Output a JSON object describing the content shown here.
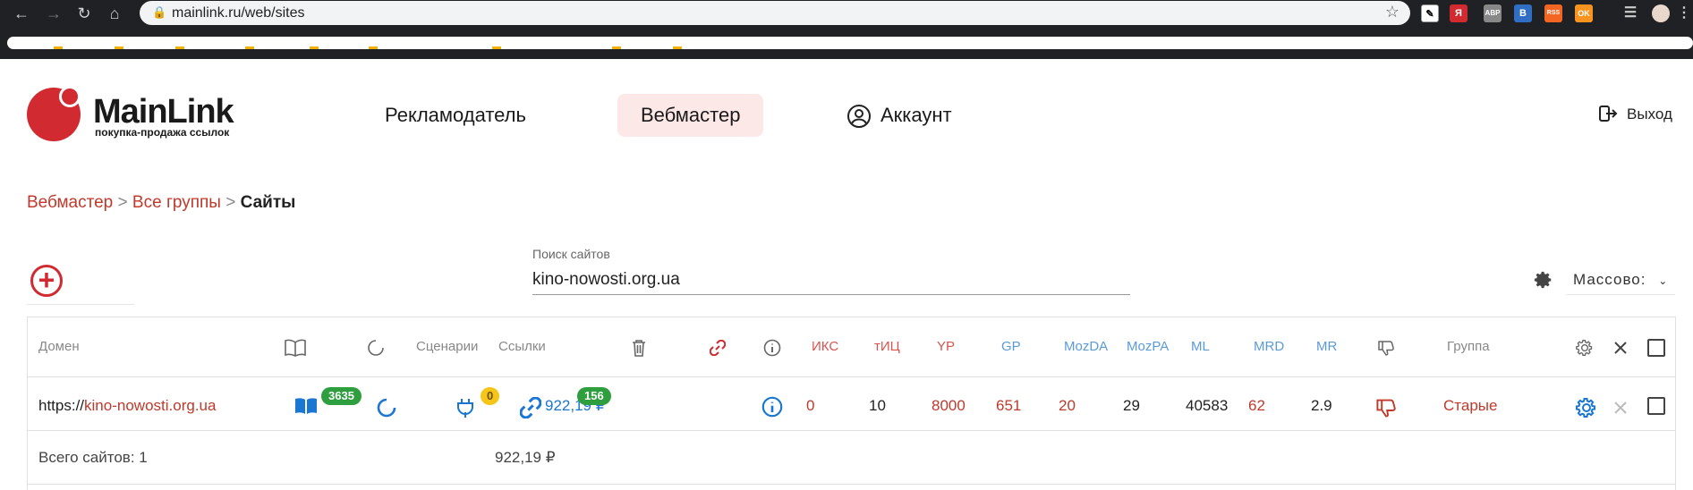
{
  "browser": {
    "url": "mainlink.ru/web/sites",
    "extensions": [
      "Я",
      "ABP",
      "B",
      "RSS",
      "OK"
    ]
  },
  "header": {
    "brand": "MainLink",
    "tagline": "покупка-продажа ссылок",
    "menu": {
      "advertiser": "Рекламодатель",
      "webmaster": "Вебмастер",
      "account": "Аккаунт"
    },
    "logout": "Выход"
  },
  "breadcrumb": {
    "webmaster": "Вебмастер",
    "sep": ">",
    "groups": "Все группы",
    "current": "Сайты"
  },
  "search": {
    "label": "Поиск сайтов",
    "value": "kino-nowosti.org.ua"
  },
  "mass_action": "Массово:",
  "table": {
    "headers": {
      "domain": "Домен",
      "scenarios": "Сценарии",
      "links": "Ссылки",
      "iks": "ИКС",
      "tic": "тИЦ",
      "yp": "YP",
      "gp": "GP",
      "mozda": "MozDA",
      "mozpa": "MozPA",
      "ml": "ML",
      "mrd": "MRD",
      "mr": "MR",
      "group": "Группа"
    },
    "row": {
      "domain_prefix": "https://",
      "domain": "kino-nowosti.org.ua",
      "pages_badge": "3635",
      "scenarios_badge": "0",
      "links_amount": "922,19 ₽",
      "links_badge": "156",
      "iks": "0",
      "tic": "10",
      "yp": "8000",
      "gp": "651",
      "mozda": "20",
      "mozpa": "29",
      "ml": "40583",
      "mrd": "62",
      "mr": "2.9",
      "group": "Старые"
    },
    "footer": {
      "total": "Всего сайтов: 1",
      "sum": "922,19 ₽"
    }
  },
  "colors": {
    "brand": "#d22a31",
    "link_red": "#c0392b",
    "blue": "#1976d2",
    "green_badge": "#2e9e3e",
    "yellow_badge": "#f5c518"
  }
}
